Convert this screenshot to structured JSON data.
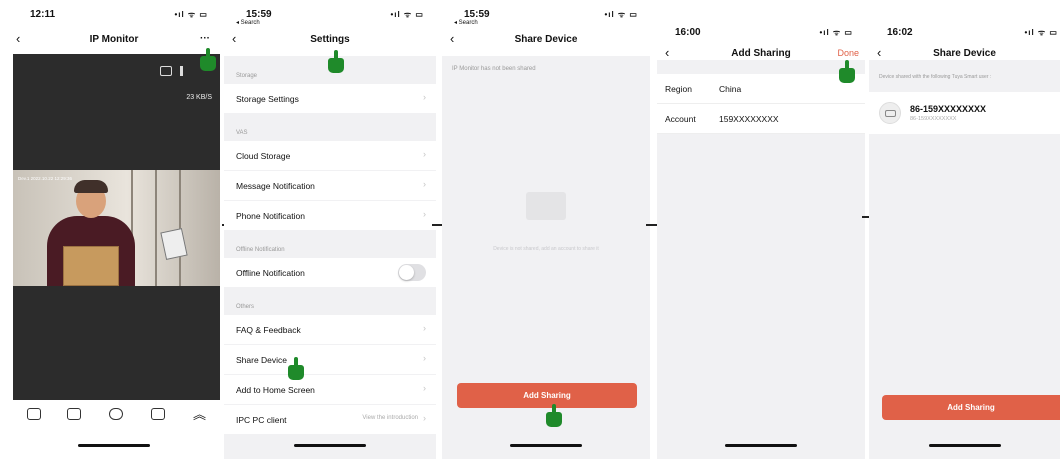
{
  "screen1": {
    "time": "12:11",
    "title": "IP Monitor",
    "more": "···",
    "speed": "23 KB/S",
    "timestamp": "Dev.1 2022.10.22 12:29:36"
  },
  "screen2": {
    "time": "15:59",
    "status_sub": "◂ Search",
    "title": "Settings",
    "sections": {
      "storage": "Storage",
      "vas": "VAS",
      "offline": "Offline Notification",
      "others": "Others"
    },
    "rows": {
      "storage_settings": "Storage Settings",
      "cloud_storage": "Cloud Storage",
      "message_notification": "Message Notification",
      "phone_notification": "Phone Notification",
      "offline_notification": "Offline Notification",
      "faq": "FAQ & Feedback",
      "share_device": "Share Device",
      "add_home": "Add to Home Screen",
      "ipc_pc": "IPC PC client",
      "ipc_pc_extra": "View the introduction"
    }
  },
  "screen3": {
    "time": "15:59",
    "status_sub": "◂ Search",
    "title": "Share Device",
    "not_shared": "IP Monitor  has not been shared",
    "empty_hint": "Device is not shared, add an account to share it",
    "add_button": "Add Sharing"
  },
  "screen4": {
    "time": "16:00",
    "title": "Add Sharing",
    "done": "Done",
    "region_label": "Region",
    "region_value": "China",
    "account_label": "Account",
    "account_value": "159XXXXXXXX"
  },
  "screen5": {
    "time": "16:02",
    "title": "Share Device",
    "caption": "Device shared with the following Tuya Smart user :",
    "user_main": "86-159XXXXXXXX",
    "user_sub": "86-159XXXXXXXX",
    "add_button": "Add Sharing"
  },
  "glyphs": {
    "back": "‹",
    "chevron": "›",
    "signal": "•ıl ᯤ ▭"
  }
}
